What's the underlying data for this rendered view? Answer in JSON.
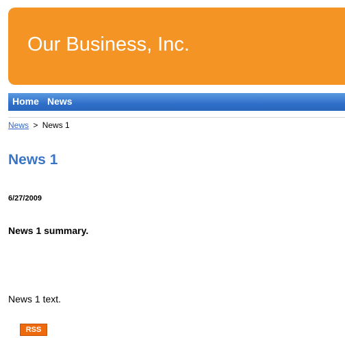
{
  "header": {
    "site_title": "Our Business, Inc."
  },
  "nav": {
    "items": [
      {
        "label": "Home"
      },
      {
        "label": "News"
      }
    ]
  },
  "breadcrumb": {
    "parent_label": "News",
    "separator": ">",
    "current_label": "News 1"
  },
  "article": {
    "title": "News 1",
    "date": "6/27/2009",
    "summary": "News 1 summary.",
    "body": "News 1 text."
  },
  "footer": {
    "rss_label": "RSS"
  },
  "colors": {
    "header_bg": "#f39424",
    "nav_bg": "#2f6fc9",
    "title_color": "#3a74c4",
    "link_color": "#3366cc",
    "rss_bg": "#ef6a0c"
  }
}
